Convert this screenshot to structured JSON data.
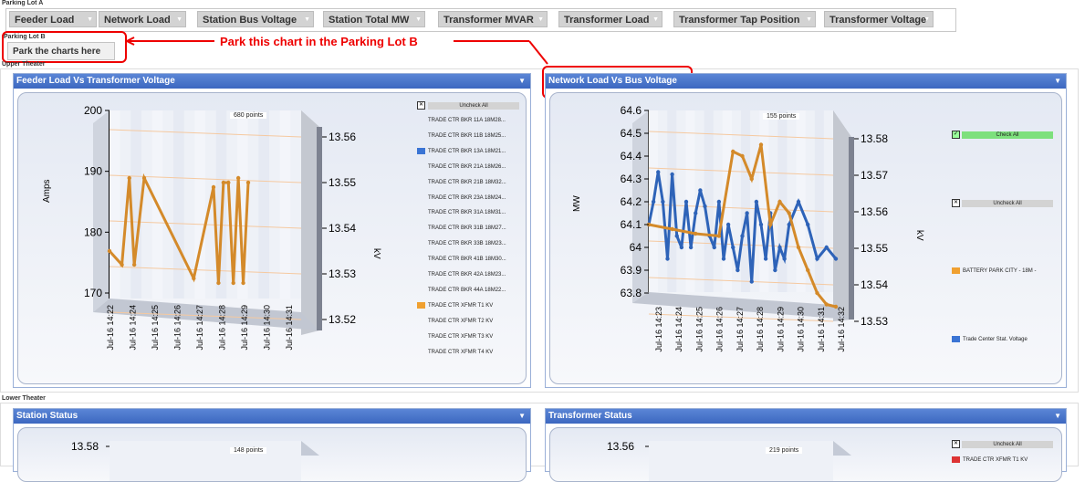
{
  "parking_lot_a": {
    "label": "Parking Lot A",
    "tabs": [
      "Feeder Load",
      "Network Load",
      "Station Bus Voltage",
      "Station Total MW",
      "Transformer MVAR",
      "Transformer Load",
      "Transformer Tap Position",
      "Transformer Voltage"
    ]
  },
  "parking_lot_b": {
    "label": "Parking Lot B",
    "placeholder": "Park the charts here",
    "annotation": "Park this chart in the Parking Lot B"
  },
  "upper_theater": {
    "label": "Upper Theater",
    "left_panel": {
      "title": "Feeder Load Vs Transformer Voltage",
      "points": "680 points",
      "y_left_label": "Amps",
      "y_right_label": "kV",
      "y_left_ticks": [
        "200",
        "190",
        "180",
        "170"
      ],
      "y_right_ticks": [
        "13.56",
        "13.55",
        "13.54",
        "13.53",
        "13.52"
      ],
      "x_ticks": [
        "Jul-16 14:22",
        "Jul-16 14:24",
        "Jul-16 14:25",
        "Jul-16 14:26",
        "Jul-16 14:27",
        "Jul-16 14:28",
        "Jul-16 14:29",
        "Jul-16 14:30",
        "Jul-16 14:31"
      ],
      "uncheck_all": "Uncheck All",
      "legend": [
        {
          "label": "TRADE CTR BKR 11A 18M28...",
          "color": ""
        },
        {
          "label": "TRADE CTR BKR 11B 18M25...",
          "color": ""
        },
        {
          "label": "TRADE CTR BKR 13A 18M21...",
          "color": "#3a74d4"
        },
        {
          "label": "TRADE CTR BKR 21A 18M26...",
          "color": ""
        },
        {
          "label": "TRADE CTR BKR 21B 18M32...",
          "color": ""
        },
        {
          "label": "TRADE CTR BKR 23A 18M24...",
          "color": ""
        },
        {
          "label": "TRADE CTR BKR 31A 18M31...",
          "color": ""
        },
        {
          "label": "TRADE CTR BKR 31B 18M27...",
          "color": ""
        },
        {
          "label": "TRADE CTR BKR 33B 18M23...",
          "color": ""
        },
        {
          "label": "TRADE CTR BKR 41B 18M30...",
          "color": ""
        },
        {
          "label": "TRADE CTR BKR 42A 18M23...",
          "color": ""
        },
        {
          "label": "TRADE CTR BKR 44A 18M22...",
          "color": ""
        },
        {
          "label": "TRADE CTR XFMR T1 KV",
          "color": "#f0a030"
        },
        {
          "label": "TRADE CTR XFMR T2 KV",
          "color": ""
        },
        {
          "label": "TRADE CTR XFMR T3 KV",
          "color": ""
        },
        {
          "label": "TRADE CTR XFMR T4 KV",
          "color": ""
        }
      ]
    },
    "right_panel": {
      "title": "Network Load Vs Bus Voltage",
      "points": "155 points",
      "y_left_label": "MW",
      "y_right_label": "kV",
      "y_left_ticks": [
        "64.6",
        "64.5",
        "64.4",
        "64.3",
        "64.2",
        "64.1",
        "64",
        "63.9",
        "63.8"
      ],
      "y_right_ticks": [
        "13.58",
        "13.57",
        "13.56",
        "13.55",
        "13.54",
        "13.53"
      ],
      "x_ticks": [
        "Jul-16 14:23",
        "Jul-16 14:24",
        "Jul-16 14:25",
        "Jul-16 14:26",
        "Jul-16 14:27",
        "Jul-16 14:28",
        "Jul-16 14:29",
        "Jul-16 14:30",
        "Jul-16 14:31",
        "Jul-16 14:32"
      ],
      "check_all": "Check All",
      "uncheck_all": "Uncheck All",
      "legend": [
        {
          "label": "BATTERY PARK CITY - 18M -",
          "color": "#f0a030"
        },
        {
          "label": "Trade Center Stat. Voltage",
          "color": "#3a74d4"
        }
      ]
    }
  },
  "lower_theater": {
    "label": "Lower Theater",
    "left_panel": {
      "title": "Station Status",
      "points": "148 points",
      "first_tick": "13.58"
    },
    "right_panel": {
      "title": "Transformer Status",
      "points": "219 points",
      "first_tick": "13.56",
      "uncheck_all": "Uncheck All",
      "legend_first": "TRADE CTR XFMR T1 KV"
    }
  },
  "chart_data": [
    {
      "type": "line",
      "title": "Feeder Load Vs Transformer Voltage",
      "ylabel": "Amps",
      "y2label": "kV",
      "ylim": [
        170,
        200
      ],
      "y2lim": [
        13.52,
        13.56
      ],
      "series": [
        {
          "name": "TRADE CTR XFMR T1 KV",
          "color": "#d48a2a",
          "x": [
            0,
            0.5,
            0.8,
            1.0,
            1.4,
            3.4,
            4.2,
            4.4,
            4.6,
            4.8,
            5.0,
            5.2,
            5.4,
            5.6
          ],
          "y": [
            13.535,
            13.532,
            13.551,
            13.532,
            13.551,
            13.529,
            13.549,
            13.528,
            13.55,
            13.55,
            13.528,
            13.551,
            13.528,
            13.55
          ]
        }
      ]
    },
    {
      "type": "line",
      "title": "Network Load Vs Bus Voltage",
      "ylabel": "MW",
      "y2label": "kV",
      "ylim": [
        63.8,
        64.6
      ],
      "y2lim": [
        13.53,
        13.58
      ],
      "series": [
        {
          "name": "Trade Center Stat. Voltage",
          "color": "#2e63b8",
          "x": [
            0,
            0.1,
            0.2,
            0.3,
            0.4,
            0.5,
            0.6,
            0.7,
            0.8,
            0.9,
            1.0,
            1.1,
            1.2,
            1.3,
            1.4,
            1.5,
            1.6,
            1.7,
            1.8,
            1.9,
            2.0,
            2.1,
            2.2,
            2.3,
            2.4,
            2.5,
            2.6,
            2.7,
            2.8,
            2.9,
            3.0,
            3.2,
            3.4,
            3.6,
            3.8,
            4.0
          ],
          "y": [
            64.1,
            64.2,
            64.33,
            64.2,
            63.95,
            64.32,
            64.05,
            64.0,
            64.2,
            64.0,
            64.15,
            64.25,
            64.18,
            64.05,
            64.0,
            64.2,
            63.95,
            64.1,
            64.0,
            63.9,
            64.05,
            64.15,
            63.85,
            64.2,
            64.1,
            63.95,
            64.15,
            63.9,
            64.0,
            63.95,
            64.1,
            64.2,
            64.1,
            63.95,
            64.0,
            63.95
          ]
        },
        {
          "name": "BATTERY PARK CITY - 18M -",
          "color": "#d48a2a",
          "x": [
            0,
            0.5,
            1.0,
            1.5,
            1.8,
            2.0,
            2.2,
            2.4,
            2.6,
            2.8,
            3.0,
            3.2,
            3.4,
            3.6,
            3.8,
            4.0
          ],
          "y": [
            64.1,
            64.08,
            64.06,
            64.05,
            64.42,
            64.4,
            64.3,
            64.45,
            64.1,
            64.2,
            64.15,
            64.0,
            63.9,
            63.8,
            63.75,
            63.74
          ]
        }
      ]
    }
  ]
}
